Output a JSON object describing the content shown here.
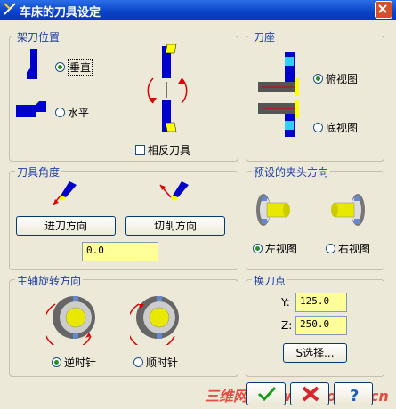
{
  "window": {
    "title": "车床的刀具设定"
  },
  "tool_holder_position": {
    "group_label": "架刀位置",
    "vertical_label": "垂直",
    "vertical_selected": true,
    "horizontal_label": "水平",
    "horizontal_selected": false,
    "reverse_tool_label": "相反刀具",
    "reverse_tool_checked": false
  },
  "tool_seat": {
    "group_label": "刀座",
    "top_view_label": "俯视图",
    "top_view_selected": true,
    "bottom_view_label": "底视图",
    "bottom_view_selected": false
  },
  "tool_angle": {
    "group_label": "刀具角度",
    "feed_direction_button": "进刀方向",
    "cutting_direction_button": "切削方向",
    "angle_value": "0.0"
  },
  "chuck_direction": {
    "group_label": "预设的夹头方向",
    "left_view_label": "左视图",
    "left_view_selected": true,
    "right_view_label": "右视图",
    "right_view_selected": false
  },
  "spindle_rotation": {
    "group_label": "主轴旋转方向",
    "ccw_label": "逆时针",
    "ccw_selected": true,
    "cw_label": "顺时针",
    "cw_selected": false
  },
  "tool_change_point": {
    "group_label": "换刀点",
    "y_label": "Y:",
    "y_value": "125.0",
    "z_label": "Z:",
    "z_value": "250.0",
    "select_button": "S选择..."
  },
  "footer": {
    "watermark": "三维网 www.3dportal.cn"
  },
  "colors": {
    "title_bar": "#0a43c9",
    "group_title": "#1a3ca8",
    "field_background": "#ffff99",
    "tool_blue": "#0000cc",
    "tool_yellow": "#ffff00",
    "arrow_red": "#dd0000"
  },
  "icons": [
    "app-icon",
    "close-icon",
    "ok-check-icon",
    "cancel-x-icon",
    "help-question-icon"
  ]
}
